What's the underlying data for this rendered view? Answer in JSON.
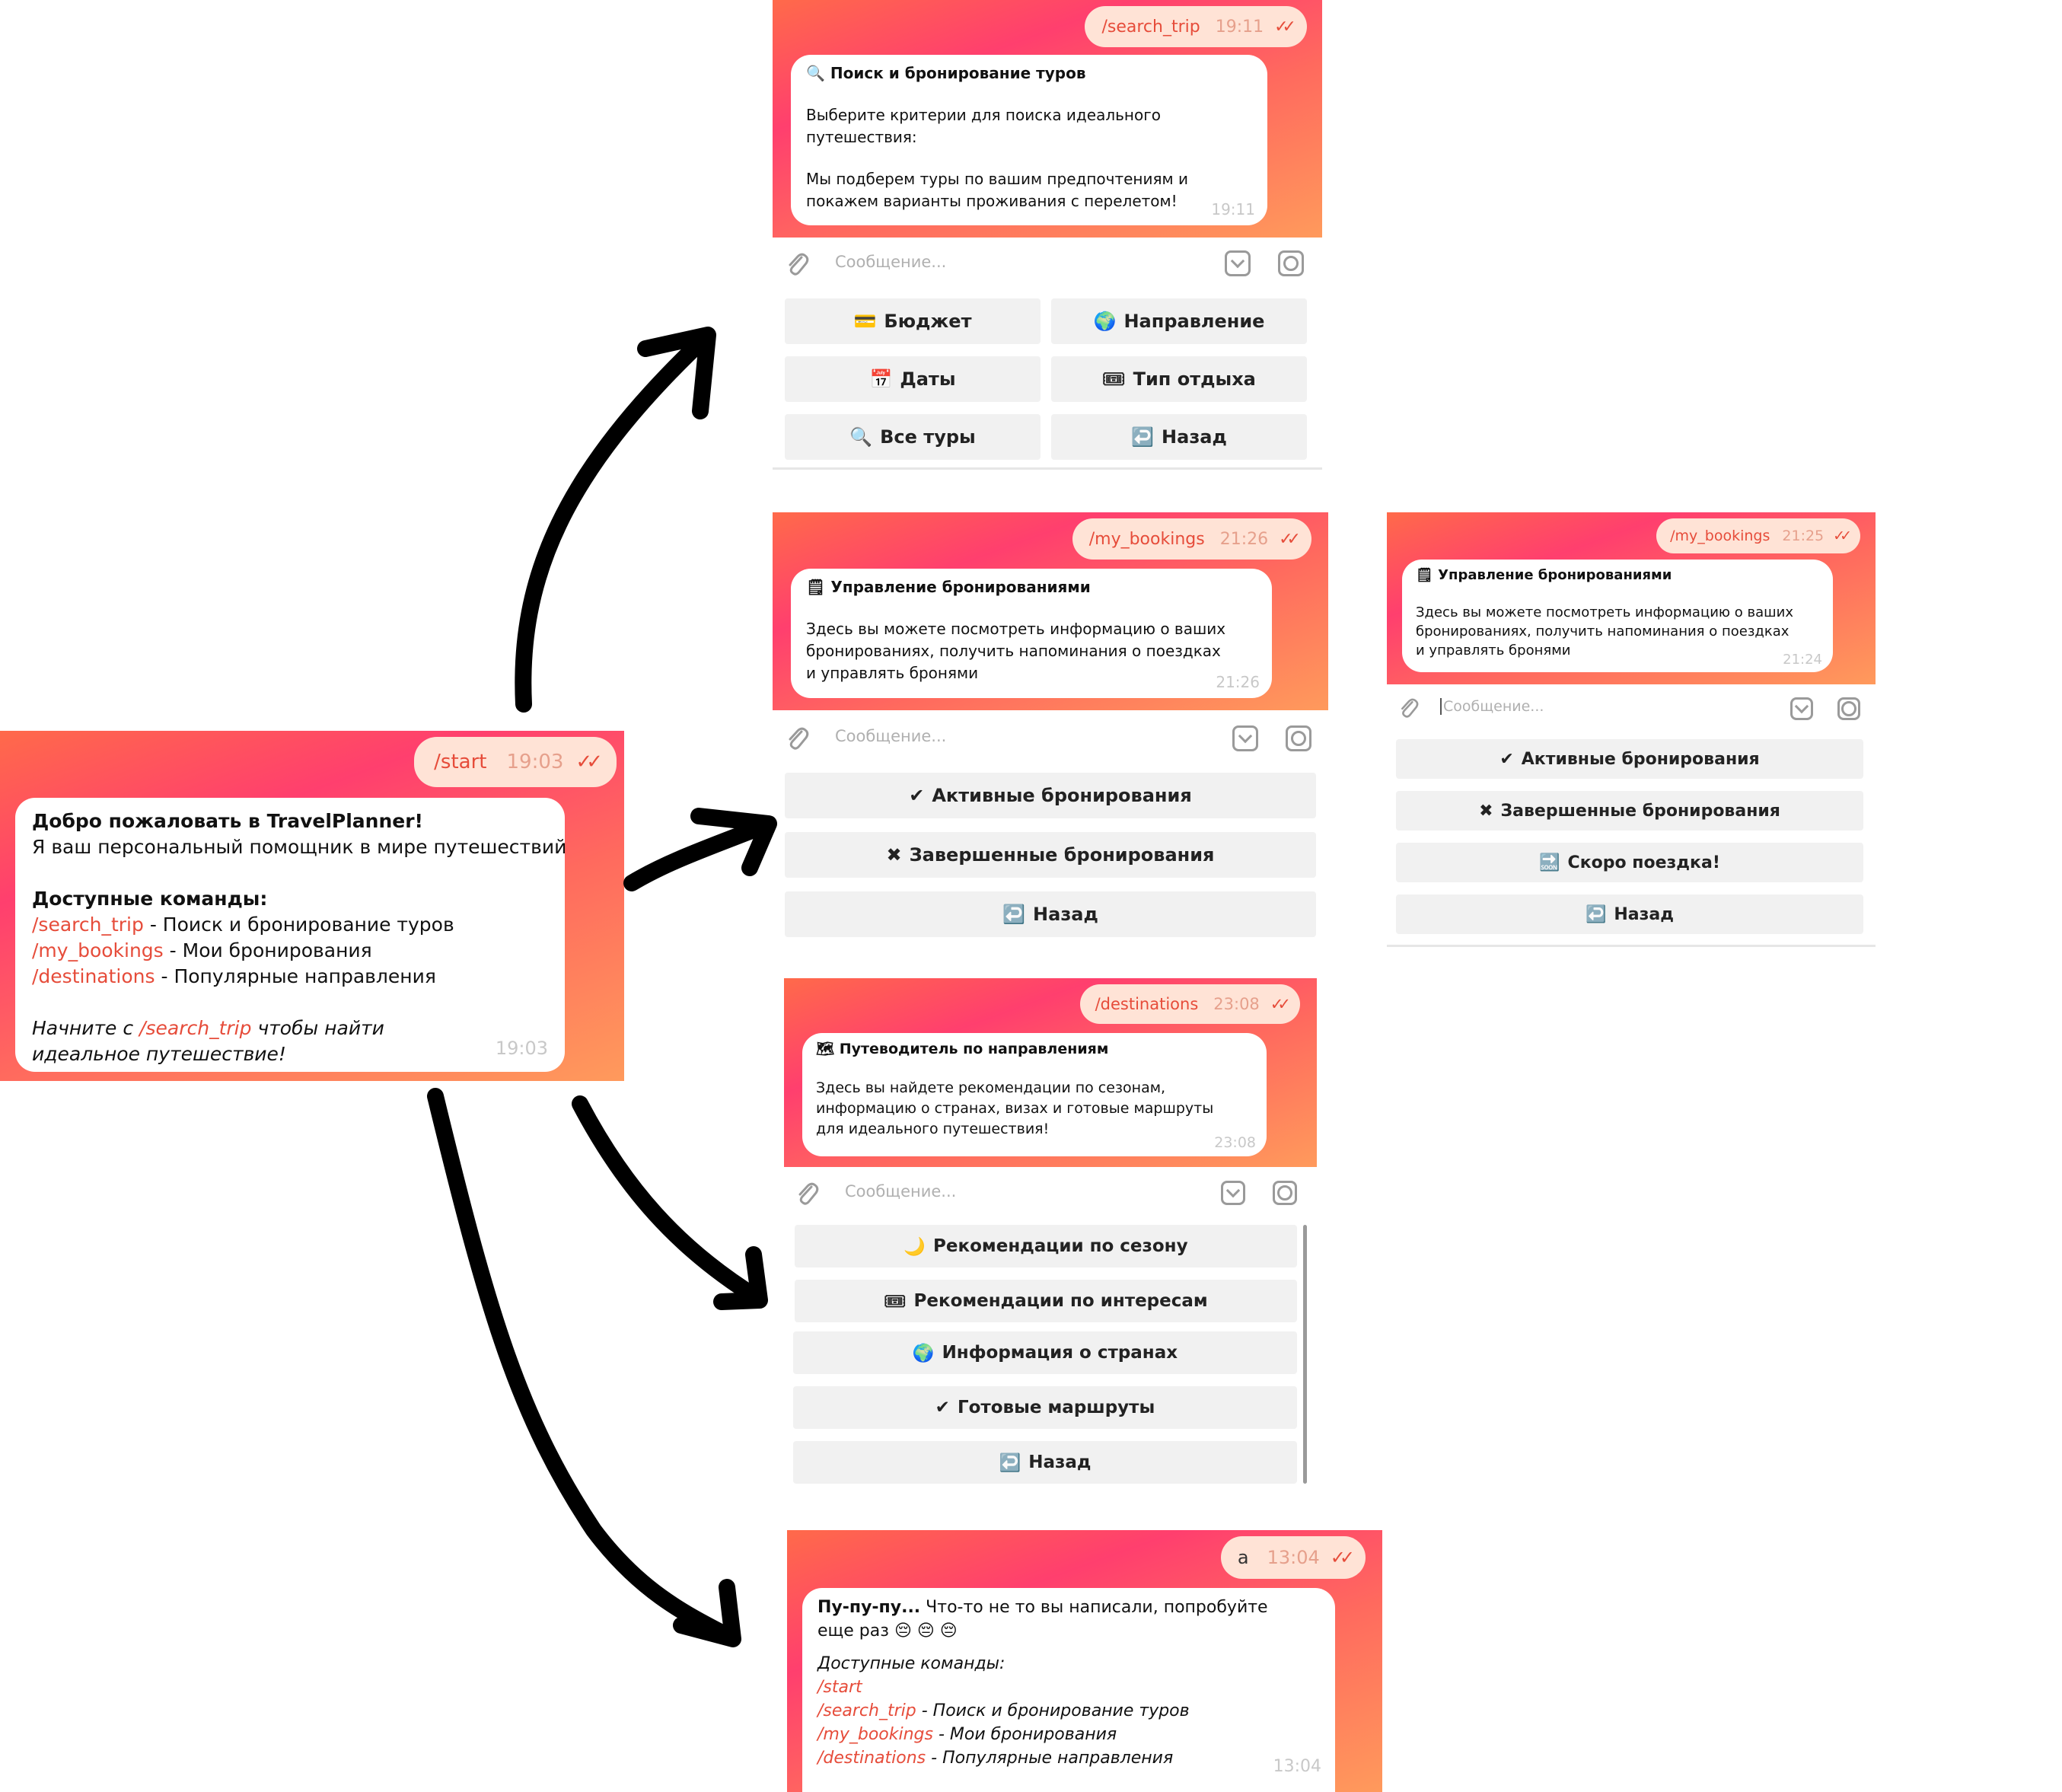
{
  "start": {
    "command": "/start",
    "command_time": "19:03",
    "title": "Добро пожаловать в TravelPlanner!",
    "subtitle": "Я ваш персональный помощник в мире путешествий",
    "commands_heading": "Доступные команды:",
    "commands": [
      {
        "cmd": "/search_trip",
        "desc": " - Поиск и бронирование туров"
      },
      {
        "cmd": "/my_bookings",
        "desc": " - Мои бронирования"
      },
      {
        "cmd": "/destinations",
        "desc": " - Популярные направления"
      }
    ],
    "hint_prefix": "Начните с ",
    "hint_cmd": "/search_trip",
    "hint_suffix": " чтобы найти идеальное путешествие!",
    "time": "19:03"
  },
  "search": {
    "command": "/search_trip",
    "command_time": "19:11",
    "title_icon": "🔍",
    "title": "Поиск и бронирование туров",
    "line1": "Выберите критерии для поиска идеального путешествия:",
    "line2": "Мы подберем туры по вашим предпочтениям и покажем варианты проживания с перелетом!",
    "time": "19:11",
    "placeholder": "Сообщение...",
    "buttons": [
      {
        "icon": "💳",
        "label": "Бюджет"
      },
      {
        "icon": "🌍",
        "label": "Направление"
      },
      {
        "icon": "📅",
        "label": "Даты"
      },
      {
        "icon": "🎟",
        "label": "Тип отдыха"
      },
      {
        "icon": "🔍",
        "label": "Все туры"
      },
      {
        "icon": "↩️",
        "label": "Назад"
      }
    ]
  },
  "bookings": {
    "command": "/my_bookings",
    "command_time": "21:26",
    "title_icon": "🗒",
    "title": "Управление бронированиями",
    "text": "Здесь вы можете посмотреть информацию о ваших бронированиях, получить напоминания о поездках и управлять бронями",
    "time": "21:26",
    "placeholder": "Сообщение...",
    "buttons": [
      {
        "icon": "✔",
        "label": "Активные бронирования"
      },
      {
        "icon": "✖",
        "label": "Завершенные бронирования"
      },
      {
        "icon": "↩️",
        "label": "Назад"
      }
    ]
  },
  "bookings2": {
    "command": "/my_bookings",
    "command_time": "21:25",
    "title_icon": "🗒",
    "title": "Управление бронированиями",
    "text": "Здесь вы можете посмотреть информацию о ваших бронированиях, получить напоминания о поездках и управлять бронями",
    "time": "21:24",
    "placeholder": "Сообщение...",
    "buttons": [
      {
        "icon": "✔",
        "label": "Активные бронирования"
      },
      {
        "icon": "✖",
        "label": "Завершенные бронирования"
      },
      {
        "icon": "🔜",
        "label": "Скоро поездка!"
      },
      {
        "icon": "↩️",
        "label": "Назад"
      }
    ]
  },
  "destinations": {
    "command": "/destinations",
    "command_time": "23:08",
    "title_icon": "🗺",
    "title": "Путеводитель по направлениям",
    "text": "Здесь вы найдете рекомендации по сезонам, информацию о странах, визах и готовые маршруты для идеального путешествия!",
    "time": "23:08",
    "placeholder": "Сообщение...",
    "buttons": [
      {
        "icon": "🌙",
        "label": "Рекомендации по сезону"
      },
      {
        "icon": "🎟",
        "label": "Рекомендации по интересам"
      },
      {
        "icon": "🌍",
        "label": "Информация о странах"
      },
      {
        "icon": "✔",
        "label": "Готовые маршруты"
      },
      {
        "icon": "↩️",
        "label": "Назад"
      }
    ]
  },
  "unknown": {
    "command": "а",
    "command_time": "13:04",
    "title_bold": "Пу-пу-пу...",
    "title_rest": " Что-то не то вы написали, попробуйте еще раз",
    "emojis": "😔 😔 😔",
    "commands_heading": "Доступные команды:",
    "commands": [
      {
        "cmd": "/start",
        "desc": ""
      },
      {
        "cmd": "/search_trip",
        "desc": " - Поиск и бронирование туров"
      },
      {
        "cmd": "/my_bookings",
        "desc": " - Мои бронирования"
      },
      {
        "cmd": "/destinations",
        "desc": " - Популярные направления"
      }
    ],
    "time": "13:04"
  },
  "colors": {
    "accent": "#e64c3a",
    "gradient_start": "#ff3f6e",
    "gradient_end": "#ff9a5c",
    "button_bg": "#f1f1f1"
  }
}
